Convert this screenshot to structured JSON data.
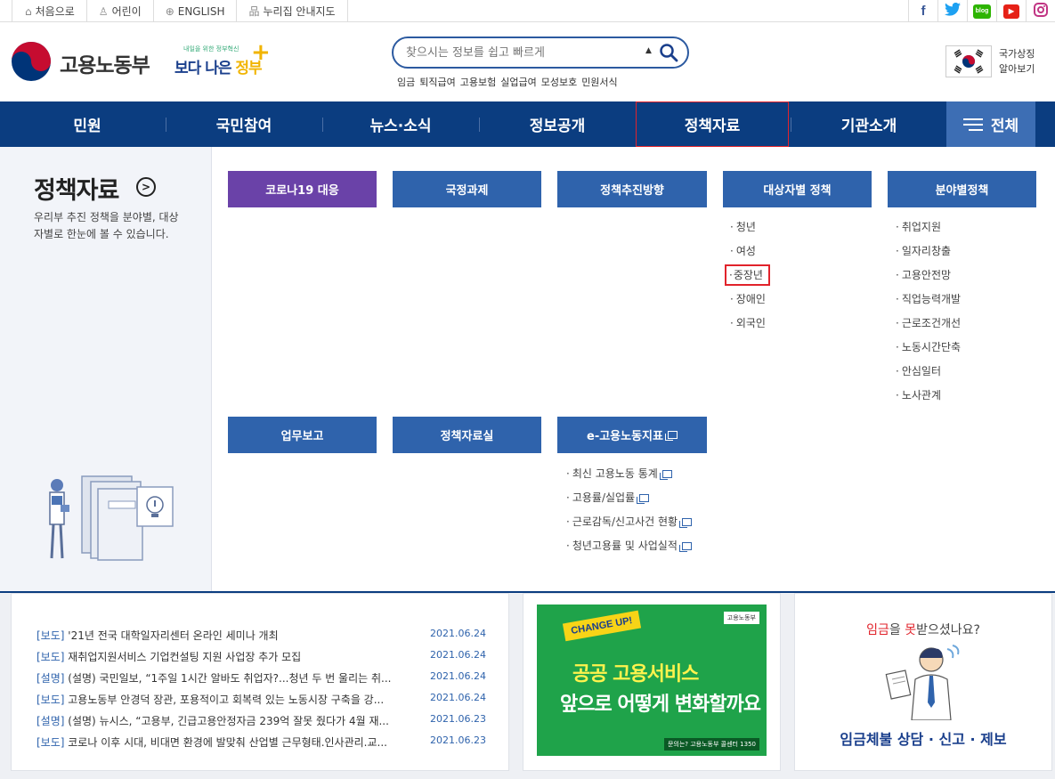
{
  "util": {
    "links": [
      {
        "icon": "home-icon",
        "label": "처음으로"
      },
      {
        "icon": "child-icon",
        "label": "어린이"
      },
      {
        "icon": "globe-icon",
        "label": "ENGLISH"
      },
      {
        "icon": "sitemap-icon",
        "label": "누리집 안내지도"
      }
    ],
    "sns": [
      {
        "name": "facebook-icon",
        "glyph": "f",
        "color": "#3b5998"
      },
      {
        "name": "twitter-icon",
        "glyph": "t",
        "color": "#1da1f2"
      },
      {
        "name": "blog-icon",
        "glyph": "blog",
        "color": "#2db400"
      },
      {
        "name": "youtube-icon",
        "glyph": "▶",
        "color": "#e62117"
      },
      {
        "name": "instagram-icon",
        "glyph": "◎",
        "color": "#c13584"
      }
    ]
  },
  "header": {
    "org_name": "고용노동부",
    "slogan_small": "내일을 위한 정부혁신",
    "slogan_big_1": "보다 나은",
    "slogan_big_2": "정부",
    "search_placeholder": "찾으시는 정보를 쉽고 빠르게",
    "quick_links": [
      "임금",
      "퇴직급여",
      "고용보험",
      "실업급여",
      "모성보호",
      "민원서식"
    ],
    "national_symbol_1": "국가상징",
    "national_symbol_2": "알아보기"
  },
  "nav": {
    "items": [
      "민원",
      "국민참여",
      "뉴스·소식",
      "정보공개",
      "정책자료",
      "기관소개"
    ],
    "all_label": "전체",
    "active": "정책자료"
  },
  "mega": {
    "title": "정책자료",
    "description": "우리부 추진 정책을 분야별, 대상자별로 한눈에 볼 수 있습니다.",
    "categories_row1": [
      "코로나19 대응",
      "국정과제",
      "정책추진방향",
      "대상자별 정책",
      "분야별정책"
    ],
    "target_policies": [
      "청년",
      "여성",
      "중장년",
      "장애인",
      "외국인"
    ],
    "field_policies": [
      "취업지원",
      "일자리창출",
      "고용안전망",
      "직업능력개발",
      "근로조건개선",
      "노동시간단축",
      "안심일터",
      "노사관계"
    ],
    "categories_row2": [
      "업무보고",
      "정책자료실",
      "e-고용노동지표"
    ],
    "indicator_links": [
      "최신 고용노동 통계",
      "고용률/실업률",
      "근로감독/신고사건 현황",
      "청년고용률 및 사업실적"
    ],
    "highlighted": "중장년"
  },
  "news": [
    {
      "tag": "[보도]",
      "text": " '21년 전국 대학일자리센터 온라인 세미나 개최",
      "date": "2021.06.24"
    },
    {
      "tag": "[보도]",
      "text": " 재취업지원서비스 기업컨설팅 지원 사업장 추가 모집",
      "date": "2021.06.24"
    },
    {
      "tag": "[설명]",
      "text": " (설명) 국민일보, “1주일 1시간 알바도 취업자?...청년 두 번 울리는 취...",
      "date": "2021.06.24"
    },
    {
      "tag": "[보도]",
      "text": " 고용노동부 안경덕 장관, 포용적이고 회복력 있는 노동시장 구축을 강...",
      "date": "2021.06.24"
    },
    {
      "tag": "[설명]",
      "text": " (설명) 뉴시스, “고용부, 긴급고용안정자금 239억 잘못 줬다가 4월 재...",
      "date": "2021.06.23"
    },
    {
      "tag": "[보도]",
      "text": " 코로나 이후 시대, 비대면 환경에 발맞춰 산업별 근무형태.인사관리.교...",
      "date": "2021.06.23"
    }
  ],
  "banner": {
    "badge": "CHANGE UP!",
    "line1": "공공 고용서비스",
    "line2": "앞으로 어떻게 변화할까요",
    "logo": "고용노동부",
    "footer": "문의는? 고용노동부 콜센터 1350"
  },
  "wage": {
    "q_red": "임금",
    "q_mid": "을 ",
    "q_red2": "못",
    "q_end": "받으셨나요?",
    "title": "임금체불 상담 · 신고 · 제보"
  }
}
